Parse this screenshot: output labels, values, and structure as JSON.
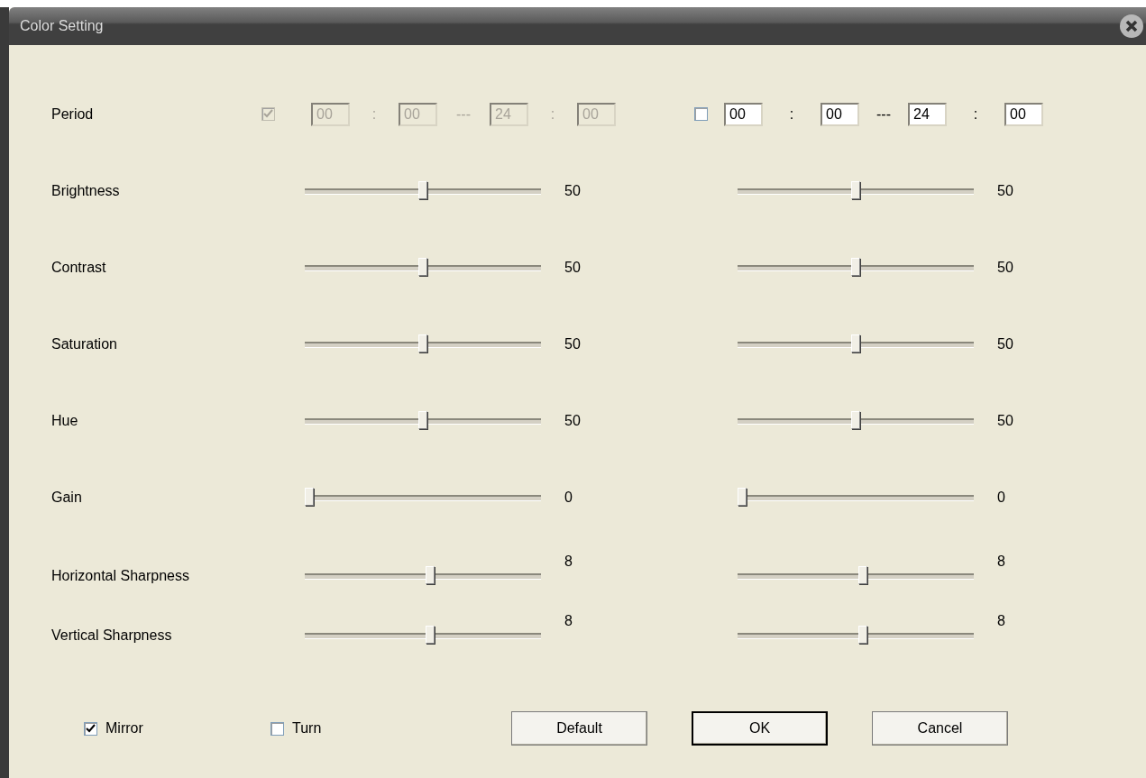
{
  "window": {
    "title": "Color Setting"
  },
  "period": {
    "label": "Period",
    "groups": [
      {
        "checked": true,
        "disabled": true,
        "fields": [
          "00",
          "00",
          "24",
          "00"
        ],
        "separators": [
          ":",
          "---",
          ":"
        ]
      },
      {
        "checked": false,
        "disabled": false,
        "fields": [
          "00",
          "00",
          "24",
          "00"
        ],
        "separators": [
          ":",
          "---",
          ":"
        ]
      }
    ]
  },
  "adjustments": [
    {
      "label": "Brightness",
      "settings": [
        {
          "level": 0.5,
          "reading": "50"
        },
        {
          "level": 0.5,
          "reading": "50"
        }
      ]
    },
    {
      "label": "Contrast",
      "settings": [
        {
          "level": 0.5,
          "reading": "50"
        },
        {
          "level": 0.5,
          "reading": "50"
        }
      ]
    },
    {
      "label": "Saturation",
      "settings": [
        {
          "level": 0.5,
          "reading": "50"
        },
        {
          "level": 0.5,
          "reading": "50"
        }
      ]
    },
    {
      "label": "Hue",
      "settings": [
        {
          "level": 0.5,
          "reading": "50"
        },
        {
          "level": 0.5,
          "reading": "50"
        }
      ]
    },
    {
      "label": "Gain",
      "settings": [
        {
          "level": 0,
          "reading": "0"
        },
        {
          "level": 0,
          "reading": "0"
        }
      ]
    },
    {
      "label": "Horizontal Sharpness",
      "settings": [
        {
          "level": 0.533,
          "reading": "8"
        },
        {
          "level": 0.533,
          "reading": "8"
        }
      ]
    },
    {
      "label": "Vertical Sharpness",
      "settings": [
        {
          "level": 0.533,
          "reading": "8"
        },
        {
          "level": 0.533,
          "reading": "8"
        }
      ]
    }
  ],
  "options": [
    {
      "label": "Mirror",
      "checked": true
    },
    {
      "label": "Turn",
      "checked": false
    }
  ],
  "buttons": [
    {
      "label": "Default",
      "focused": false
    },
    {
      "label": "OK",
      "focused": true
    },
    {
      "label": "Cancel",
      "focused": false
    }
  ]
}
